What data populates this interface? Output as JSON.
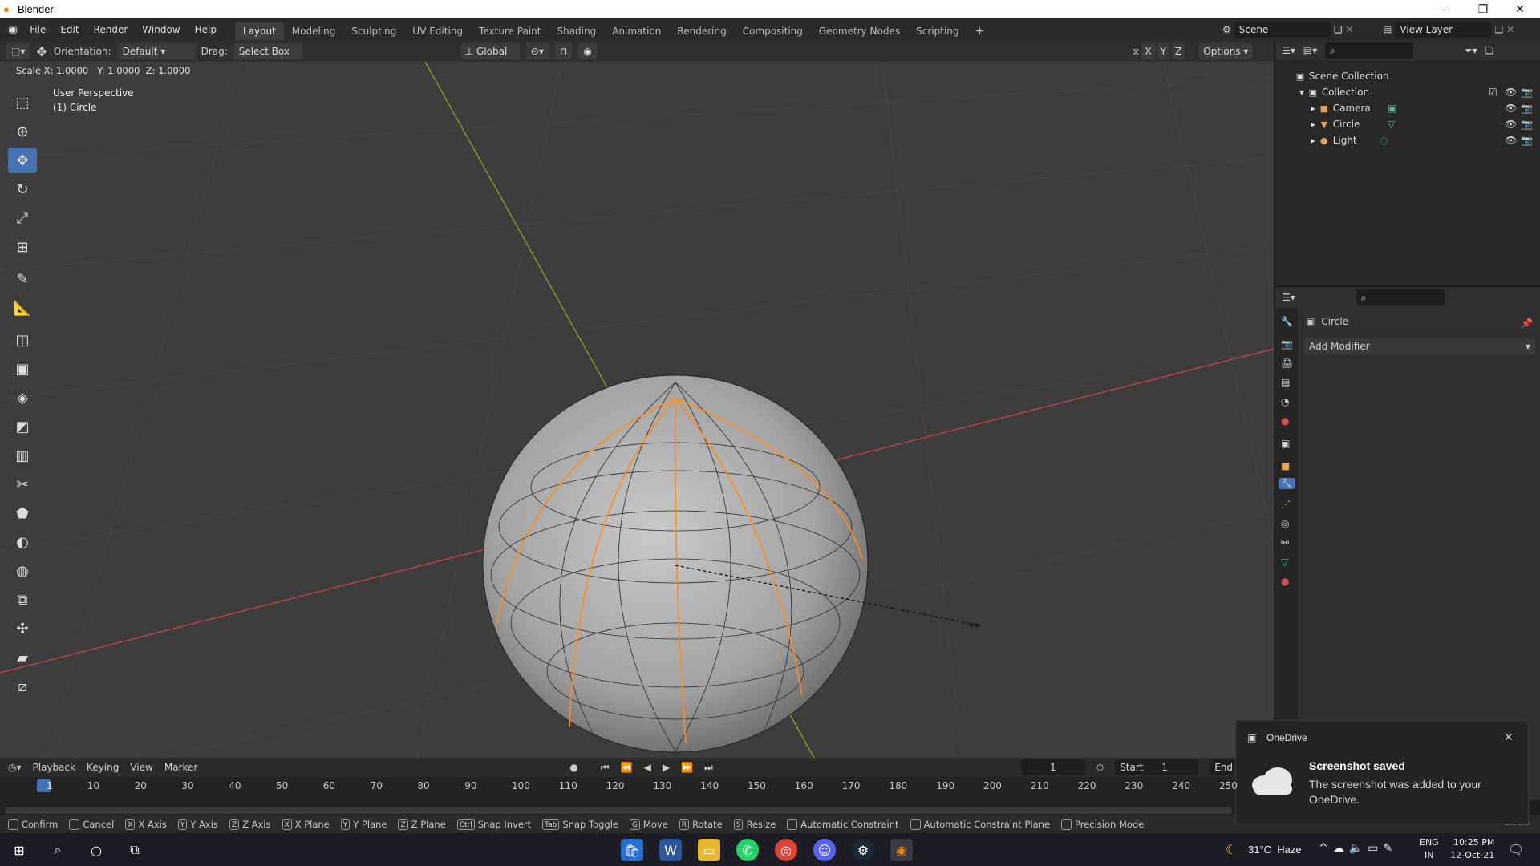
{
  "app": {
    "title": "Blender"
  },
  "menus": [
    "File",
    "Edit",
    "Render",
    "Window",
    "Help"
  ],
  "workspaces": [
    "Layout",
    "Modeling",
    "Sculpting",
    "UV Editing",
    "Texture Paint",
    "Shading",
    "Animation",
    "Rendering",
    "Compositing",
    "Geometry Nodes",
    "Scripting"
  ],
  "active_workspace": "Layout",
  "scene": {
    "name": "Scene",
    "view_layer": "View Layer"
  },
  "viewport_header": {
    "orientation_label": "Orientation:",
    "orientation_value": "Default",
    "drag_label": "Drag:",
    "drag_value": "Select Box",
    "transform_orientation": "Global",
    "axes": [
      "X",
      "Y",
      "Z"
    ],
    "options_label": "Options"
  },
  "operator_readout": "Scale X: 1.0000   Y: 1.0000  Z: 1.0000",
  "viewport_info": {
    "perspective": "User Perspective",
    "object": "(1) Circle"
  },
  "outliner": {
    "root": "Scene Collection",
    "collection": "Collection",
    "items": [
      {
        "name": "Camera",
        "icon": "camera-icon"
      },
      {
        "name": "Circle",
        "icon": "mesh-icon"
      },
      {
        "name": "Light",
        "icon": "light-icon"
      }
    ]
  },
  "properties": {
    "object_name": "Circle",
    "add_modifier_label": "Add Modifier"
  },
  "timeline": {
    "menus": [
      "Playback",
      "Keying",
      "View",
      "Marker"
    ],
    "current_frame": "1",
    "start_label": "Start",
    "start_value": "1",
    "end_label": "End",
    "ruler": [
      "1",
      "10",
      "20",
      "30",
      "40",
      "50",
      "60",
      "70",
      "80",
      "90",
      "100",
      "110",
      "120",
      "130",
      "140",
      "150",
      "160",
      "170",
      "180",
      "190",
      "200",
      "210",
      "220",
      "230",
      "240",
      "250"
    ]
  },
  "statusbar": [
    {
      "key": "",
      "label": "Confirm"
    },
    {
      "key": "",
      "label": "Cancel"
    },
    {
      "key": "X",
      "label": "X Axis"
    },
    {
      "key": "Y",
      "label": "Y Axis"
    },
    {
      "key": "Z",
      "label": "Z Axis"
    },
    {
      "key": "X",
      "label": "X Plane"
    },
    {
      "key": "Y",
      "label": "Y Plane"
    },
    {
      "key": "Z",
      "label": "Z Plane"
    },
    {
      "key": "Ctrl",
      "label": "Snap Invert"
    },
    {
      "key": "Tab",
      "label": "Snap Toggle"
    },
    {
      "key": "G",
      "label": "Move"
    },
    {
      "key": "R",
      "label": "Rotate"
    },
    {
      "key": "S",
      "label": "Resize"
    },
    {
      "key": "",
      "label": "Automatic Constraint"
    },
    {
      "key": "",
      "label": "Automatic Constraint Plane"
    },
    {
      "key": "",
      "label": "Precision Mode"
    }
  ],
  "version": "2.93.5",
  "toast": {
    "app": "OneDrive",
    "title": "Screenshot saved",
    "body": "The screenshot was added to your OneDrive."
  },
  "taskbar": {
    "weather": "31°C  Haze",
    "lang": "ENG",
    "region": "IN",
    "time": "10:25 PM",
    "date": "12-Oct-21"
  },
  "colors": {
    "accent": "#4772b3",
    "selection": "#ff8c1a",
    "x_axis": "#c0444f",
    "y_axis": "#7ea12c",
    "viewport_bg": "#3d3d3d"
  }
}
